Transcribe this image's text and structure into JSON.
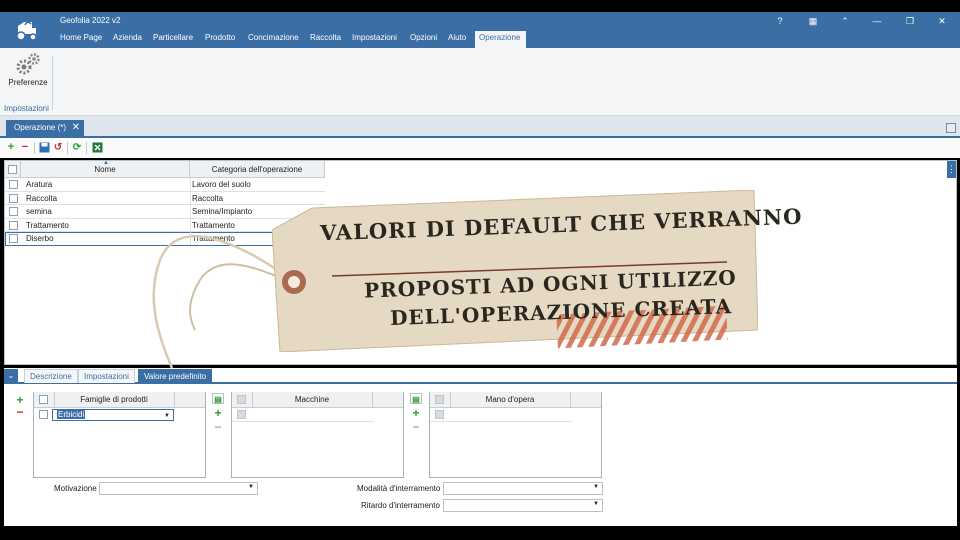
{
  "app": {
    "title": "Geofolia 2022 v2"
  },
  "menu": [
    "Home Page",
    "Azienda",
    "Particellare",
    "Prodotto",
    "Concimazione",
    "Raccolta",
    "Impostazioni",
    "Opzioni",
    "Aiuto",
    "Operazione"
  ],
  "menu_active": "Operazione",
  "window_controls": [
    "help-icon",
    "calculator-icon",
    "restore-ribbon-icon",
    "minimize-icon",
    "maximize-icon",
    "close-icon"
  ],
  "ribbon": {
    "button_label": "Preferenze",
    "group_label": "Impostazioni"
  },
  "doc_tab": {
    "label": "Operazione (*)",
    "close": "✕"
  },
  "grid": {
    "columns": [
      "Nome",
      "Categoria dell'operazione"
    ],
    "rows": [
      {
        "nome": "Aratura",
        "categoria": "Lavoro del suolo"
      },
      {
        "nome": "Raccolta",
        "categoria": "Raccolta"
      },
      {
        "nome": "semina",
        "categoria": "Semina/Impianto"
      },
      {
        "nome": "Trattamento",
        "categoria": "Trattamento"
      },
      {
        "nome": "Diserbo",
        "categoria": "Trattamento"
      }
    ]
  },
  "bottom_tabs": [
    "Descrizione",
    "Impostazioni",
    "Valore predefinito"
  ],
  "bottom_tab_active": "Valore predefinito",
  "subgrids": {
    "famiglie": {
      "header": "Famiglie di prodotti",
      "value": "Erbicidi"
    },
    "macchine": {
      "header": "Macchine"
    },
    "mano": {
      "header": "Mano d'opera"
    }
  },
  "fields": {
    "motivazione": {
      "label": "Motivazione",
      "value": ""
    },
    "modalita": {
      "label": "Modalità d'interramento",
      "value": ""
    },
    "ritardo": {
      "label": "Ritardo d'interramento",
      "value": ""
    }
  },
  "overlay": {
    "line1": "VALORI DI DEFAULT CHE VERRANNO",
    "line2": "PROPOSTI AD OGNI UTILIZZO",
    "line3": "DELL'OPERAZIONE CREATA"
  },
  "colors": {
    "accent": "#3b6ea5",
    "tag": "#e8dcc8",
    "stripe": "#d06a4a"
  }
}
